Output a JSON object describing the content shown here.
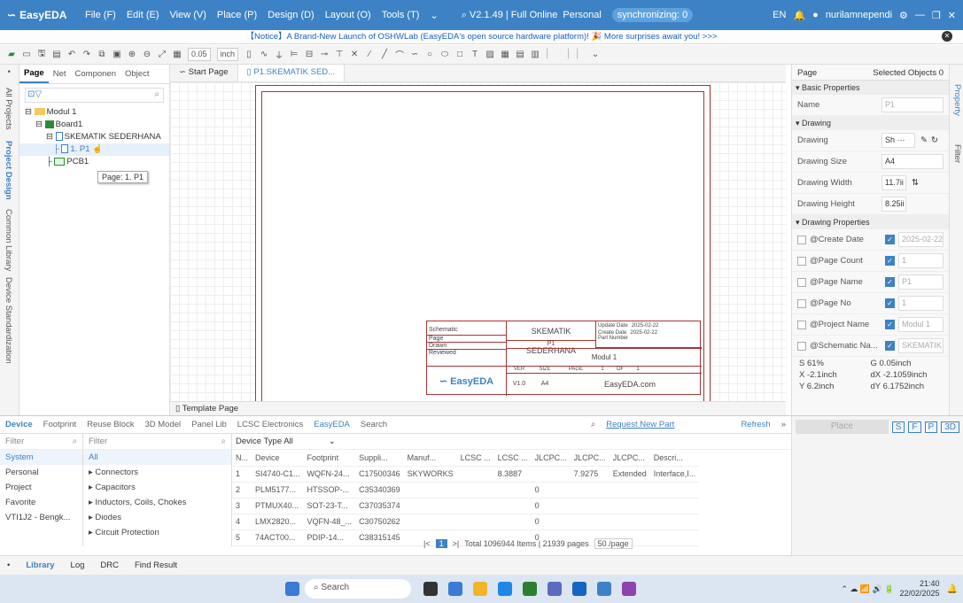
{
  "app": {
    "name": "EasyEDA"
  },
  "menu": [
    "File (F)",
    "Edit (E)",
    "View (V)",
    "Place (P)",
    "Design (D)",
    "Layout (O)",
    "Tools (T)"
  ],
  "version": "V2.1.49 | Full Online",
  "plan": "Personal",
  "sync": "synchronizing: 0",
  "lang": "EN",
  "user": "nurilamnependi",
  "notice": "【Notice】A Brand-New Launch of OSHWLab (EasyEDA's open source hardware platform)! 🎉 More surprises await you! >>>",
  "toolbar": {
    "grid": "0.05",
    "unit": "inch"
  },
  "left": {
    "tabs": [
      "Page",
      "Net",
      "Componen",
      "Object"
    ],
    "vtabs": [
      "All Projects",
      "Project Design",
      "Common Library",
      "Device Standardization"
    ],
    "tree": {
      "modul": "Modul 1",
      "board": "Board1",
      "schematic": "SKEMATIK SEDERHANA",
      "page": "1. P1",
      "pcb": "PCB1"
    },
    "tooltip": "Page: 1. P1"
  },
  "canvas": {
    "tabs": [
      "Start Page",
      "P1.SKEMATIK SED..."
    ],
    "page_tab": "Template Page",
    "titleblock": {
      "schematic_label": "Schematic",
      "page_label": "Page",
      "drawn_label": "Drawn",
      "reviewed_label": "Reviewed",
      "title": "SKEMATIK SEDERHANA",
      "page_value": "P1",
      "update_date_label": "Update Date",
      "create_date_label": "Create Date",
      "part_number_label": "Part Number",
      "update_date": "2025-02-22",
      "create_date": "2025-02-22",
      "project": "Modul 1",
      "ver_label": "VER",
      "size_label": "SIZE",
      "page_no_label": "PAGE",
      "of_label": "OF",
      "ver": "V1.0",
      "size": "A4",
      "page_no": "1",
      "of": "1",
      "logo": "EasyEDA",
      "site": "EasyEDA.com"
    }
  },
  "right": {
    "tabs": [
      "Page",
      "Selected Objects  0"
    ],
    "vtabs": [
      "Property",
      "Filter"
    ],
    "basic": "Basic Properties",
    "name_label": "Name",
    "name_value": "P1",
    "drawing_section": "Drawing",
    "drawing_label": "Drawing",
    "drawing_value": "Sh ···",
    "size_label": "Drawing Size",
    "size_value": "A4",
    "width_label": "Drawing Width",
    "width_value": "11.7ii",
    "height_label": "Drawing Height",
    "height_value": "8.25ii",
    "dp_section": "Drawing Properties",
    "props": [
      {
        "label": "@Create Date",
        "value": "2025-02-22"
      },
      {
        "label": "@Page Count",
        "value": "1"
      },
      {
        "label": "@Page Name",
        "value": "P1"
      },
      {
        "label": "@Page No",
        "value": "1"
      },
      {
        "label": "@Project Name",
        "value": "Modul 1"
      },
      {
        "label": "@Schematic Na...",
        "value": "SKEMATIK SEI"
      }
    ],
    "status": {
      "s": "S  61%",
      "g": "G  0.05inch",
      "x": "X  -2.1inch",
      "dx": "dX  -2.1059inch",
      "y": "Y  6.2inch",
      "dy": "dY  6.1752inch"
    }
  },
  "bottom": {
    "tabs": [
      "Device",
      "Footprint",
      "Reuse Block",
      "3D Model",
      "Panel Lib",
      "LCSC Electronics",
      "EasyEDA",
      "Search"
    ],
    "request": "Request New Part",
    "refresh": "Refresh",
    "filter_label": "Filter",
    "filter_placeholder": "Filter",
    "device_type": "Device Type  All",
    "libs": [
      "System",
      "Personal",
      "Project",
      "Favorite",
      "VTI1J2 - Bengk..."
    ],
    "cats": [
      "All",
      "▸ Connectors",
      "▸ Capacitors",
      "▸ Inductors, Coils, Chokes",
      "▸ Diodes",
      "▸ Circuit Protection"
    ],
    "headers": [
      "N...",
      "Device",
      "Footprint",
      "Suppli...",
      "Manuf...",
      "LCSC ...",
      "LCSC ...",
      "JLCPC...",
      "JLCPC...",
      "JLCPC...",
      "Descri..."
    ],
    "rows": [
      [
        "1",
        "SI4740-C1...",
        "WQFN-24...",
        "C17500346",
        "SKYWORKS",
        "",
        "8.3887",
        "",
        "7.9275",
        "Extended",
        "Interface,I..."
      ],
      [
        "2",
        "PLM5177...",
        "HTSSOP-...",
        "C35340369",
        "",
        "",
        "",
        "0",
        "",
        "",
        ""
      ],
      [
        "3",
        "PTMUX40...",
        "SOT-23-T...",
        "C37035374",
        "",
        "",
        "",
        "0",
        "",
        "",
        ""
      ],
      [
        "4",
        "LMX2820...",
        "VQFN-48_...",
        "C30750262",
        "",
        "",
        "",
        "0",
        "",
        "",
        ""
      ],
      [
        "5",
        "74ACT00...",
        "PDIP-14...",
        "C38315145",
        "",
        "",
        "",
        "0",
        "",
        "",
        ""
      ]
    ],
    "page_current": "1",
    "total": "Total 1096944 Items | 21939 pages",
    "per_page": "50 /page"
  },
  "place": {
    "button": "Place",
    "s": "S",
    "f": "F",
    "p": "P",
    "d3": "3D"
  },
  "statusbar": [
    "Library",
    "Log",
    "DRC",
    "Find Result"
  ],
  "taskbar": {
    "search": "Search",
    "time": "21:40",
    "date": "22/02/2025"
  }
}
